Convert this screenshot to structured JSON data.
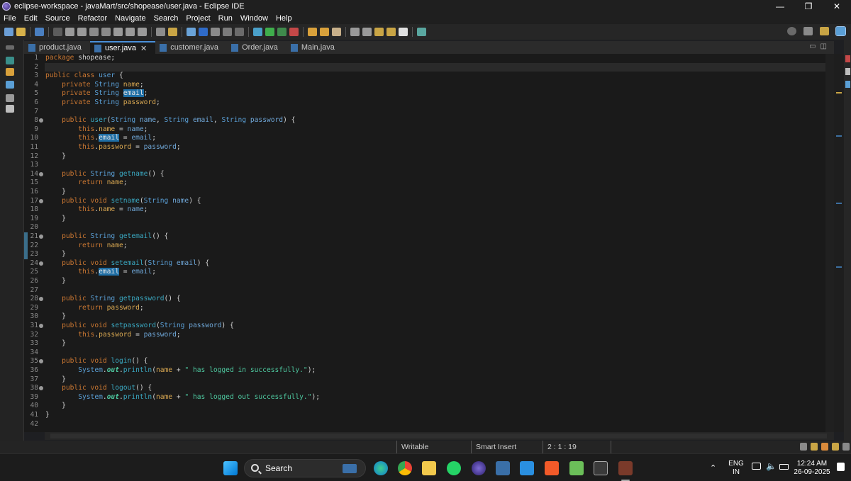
{
  "window": {
    "title": "eclipse-workspace - javaMart/src/shopease/user.java - Eclipse IDE",
    "minimize": "—",
    "restore": "❐",
    "close": "✕"
  },
  "menu": [
    "File",
    "Edit",
    "Source",
    "Refactor",
    "Navigate",
    "Search",
    "Project",
    "Run",
    "Window",
    "Help"
  ],
  "tabs": [
    {
      "label": "product.java",
      "active": false
    },
    {
      "label": "user.java",
      "active": true,
      "close": "✕"
    },
    {
      "label": "customer.java",
      "active": false
    },
    {
      "label": "Order.java",
      "active": false
    },
    {
      "label": "Main.java",
      "active": false
    }
  ],
  "editor": {
    "line_numbers": [
      "1",
      "2",
      "3",
      "4",
      "5",
      "6",
      "7",
      "8",
      "9",
      "10",
      "11",
      "12",
      "13",
      "14",
      "15",
      "16",
      "17",
      "18",
      "19",
      "20",
      "21",
      "22",
      "23",
      "24",
      "25",
      "26",
      "27",
      "28",
      "29",
      "30",
      "31",
      "32",
      "33",
      "34",
      "35",
      "36",
      "37",
      "38",
      "39",
      "40",
      "41",
      "42"
    ],
    "current_line": 2
  },
  "status": {
    "mode": "Writable",
    "insert": "Smart Insert",
    "position": "2 : 1 : 19"
  },
  "taskbar": {
    "search_label": "Search",
    "lang_top": "ENG",
    "lang_bottom": "IN",
    "time": "12:24 AM",
    "date": "26-09-2025"
  },
  "colors": {
    "keyword": "#cc7832",
    "type": "#5a9fd6",
    "string": "#4ec9a0",
    "selection": "#1f6fa6"
  }
}
